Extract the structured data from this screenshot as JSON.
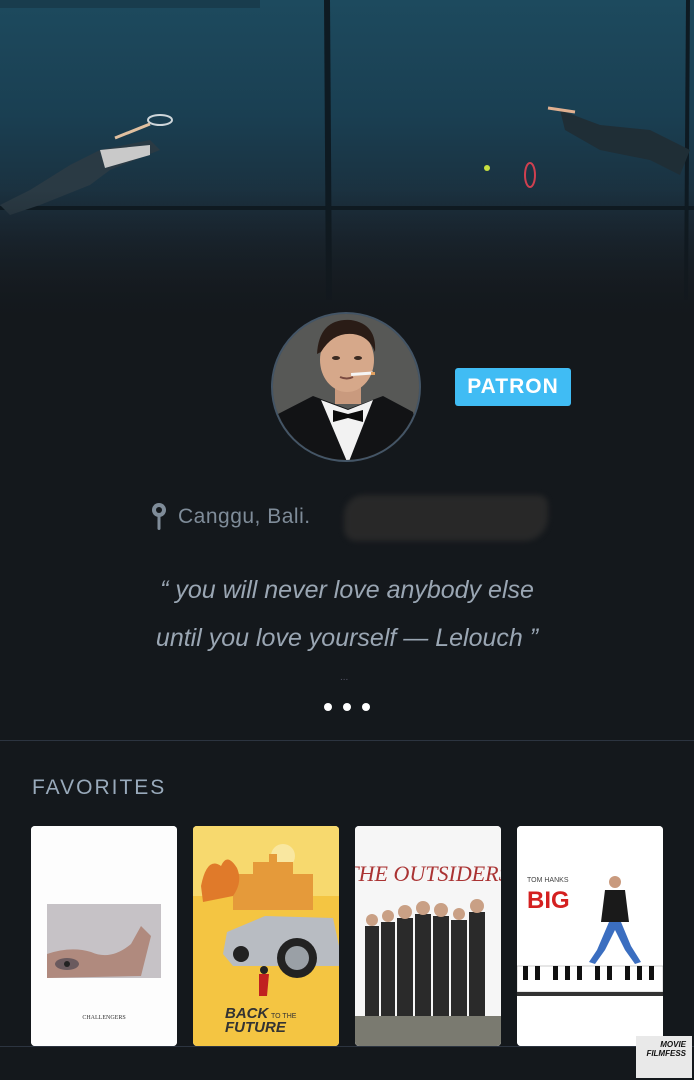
{
  "profile": {
    "badge": "PATRON",
    "location": "Canggu, Bali.",
    "bio_line1": "“ you will never love anybody else",
    "bio_line2": "until you love yourself — Lelouch ”",
    "tiny_dots": "...",
    "more_icon": "ellipsis-icon"
  },
  "favorites": {
    "title": "FAVORITES",
    "films": [
      {
        "title": "Challengers",
        "poster_text": "CHALLENGERS"
      },
      {
        "title": "Back to the Future",
        "poster_text_1": "BACK",
        "poster_text_2": "TO THE",
        "poster_text_3": "FUTURE"
      },
      {
        "title": "The Outsiders",
        "poster_text": "THE OUTSIDERS"
      },
      {
        "title": "Big",
        "poster_text_1": "TOM HANKS",
        "poster_text_2": "BIG"
      }
    ]
  },
  "watermark": {
    "line1": "MOVIE",
    "line2": "FILMFESS"
  },
  "colors": {
    "background": "#14181c",
    "badge": "#40bcf4",
    "text": "#9aa6b3"
  }
}
